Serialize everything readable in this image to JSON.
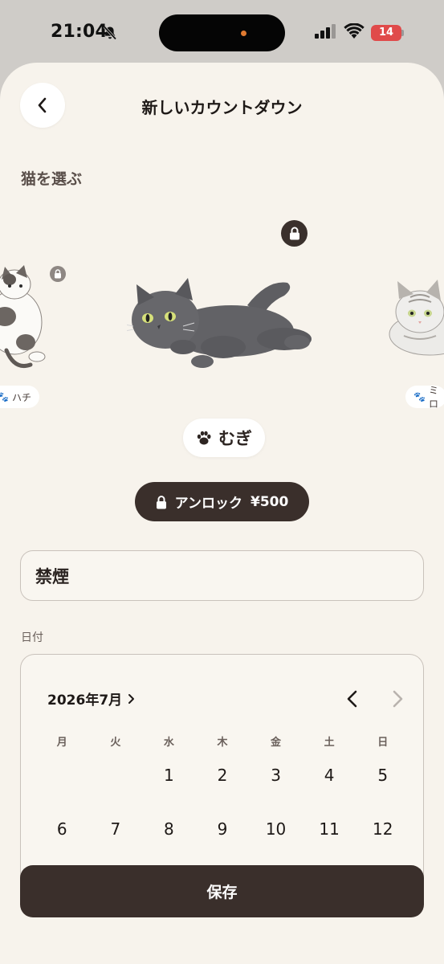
{
  "status_bar": {
    "time": "21:04",
    "battery": "14"
  },
  "header": {
    "title": "新しいカウントダウン"
  },
  "cat_picker": {
    "section_label": "猫を選ぶ",
    "left_cat": "ハチ",
    "selected_cat": "むぎ",
    "right_cat": "ミロ",
    "unlock_label": "アンロック",
    "unlock_price": "¥500"
  },
  "form": {
    "title_value": "禁煙",
    "date_label": "日付"
  },
  "calendar": {
    "month": "2026年7月",
    "weekdays": [
      "月",
      "火",
      "水",
      "木",
      "金",
      "土",
      "日"
    ],
    "days": [
      "",
      "",
      "1",
      "2",
      "3",
      "4",
      "5",
      "6",
      "7",
      "8",
      "9",
      "10",
      "11",
      "12"
    ]
  },
  "footer": {
    "save_label": "保存"
  }
}
